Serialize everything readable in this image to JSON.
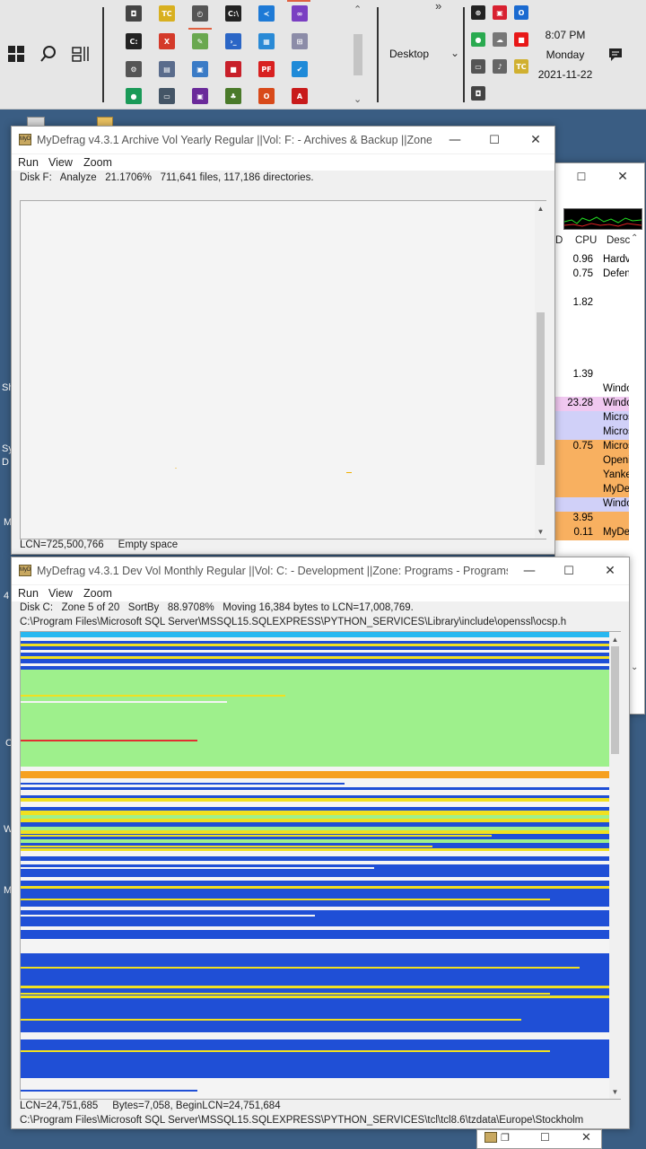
{
  "taskbar": {
    "toolbar_label": "Desktop",
    "overflow_glyph": "»",
    "clock": {
      "time": "8:07 PM",
      "day": "Monday",
      "date": "2021-11-22"
    },
    "pinned_icons": [
      {
        "name": "camera-tool-icon",
        "bg": "#444444",
        "glyph": "◘"
      },
      {
        "name": "tc-tool-icon",
        "bg": "#d8b020",
        "glyph": "TC"
      },
      {
        "name": "clock-check-icon",
        "bg": "#555555",
        "glyph": "◴"
      },
      {
        "name": "console-icon",
        "bg": "#222222",
        "glyph": "C:\\"
      },
      {
        "name": "vscode-icon",
        "bg": "#1e7ad6",
        "glyph": "≺"
      },
      {
        "name": "visual-studio-icon",
        "bg": "#7a3fc2",
        "glyph": "∞"
      },
      {
        "name": "command-prompt-icon",
        "bg": "#222222",
        "glyph": "C:"
      },
      {
        "name": "vcxsrv-icon",
        "bg": "#d43a2a",
        "glyph": "X"
      },
      {
        "name": "paint-icon",
        "bg": "#6aa84f",
        "glyph": "✎"
      },
      {
        "name": "powershell-icon",
        "bg": "#2b66c6",
        "glyph": "›_"
      },
      {
        "name": "calculator-grid-icon",
        "bg": "#2a8ad6",
        "glyph": "▦"
      },
      {
        "name": "network-tool-icon",
        "bg": "#8c8ca8",
        "glyph": "⊞"
      },
      {
        "name": "settings-icon",
        "bg": "#555555",
        "glyph": "⚙"
      },
      {
        "name": "server-manager-icon",
        "bg": "#5a6c8c",
        "glyph": "▤"
      },
      {
        "name": "control-panel-icon",
        "bg": "#3a7bc6",
        "glyph": "▣"
      },
      {
        "name": "red-app-icon",
        "bg": "#c8202a",
        "glyph": "■"
      },
      {
        "name": "pdf-editor-icon",
        "bg": "#d82020",
        "glyph": "PF"
      },
      {
        "name": "checklist-icon",
        "bg": "#1e8ad8",
        "glyph": "✔"
      },
      {
        "name": "green-app-icon",
        "bg": "#1a9a58",
        "glyph": "●"
      },
      {
        "name": "monitor-tool-icon",
        "bg": "#445566",
        "glyph": "▭"
      },
      {
        "name": "hyperv-icon",
        "bg": "#6a2a9a",
        "glyph": "▣"
      },
      {
        "name": "tree-app-icon",
        "bg": "#4a7a2a",
        "glyph": "♣"
      },
      {
        "name": "office-icon",
        "bg": "#d84a1a",
        "glyph": "O"
      },
      {
        "name": "acrobat-icon",
        "bg": "#c81a1a",
        "glyph": "A"
      }
    ],
    "tray_icons": [
      {
        "name": "tray-circle-icon",
        "bg": "#222222",
        "glyph": "⊛"
      },
      {
        "name": "tray-red-icon",
        "bg": "#d82030",
        "glyph": "▣"
      },
      {
        "name": "tray-outlook-icon",
        "bg": "#1a6ad0",
        "glyph": "O"
      },
      {
        "name": "tray-green-owl-icon",
        "bg": "#2aaa50",
        "glyph": "●"
      },
      {
        "name": "onedrive-icon",
        "bg": "#777777",
        "glyph": "☁"
      },
      {
        "name": "tray-stop-icon",
        "bg": "#e81818",
        "glyph": "■"
      },
      {
        "name": "network-icon",
        "bg": "#555555",
        "glyph": "▭"
      },
      {
        "name": "volume-icon",
        "bg": "#666666",
        "glyph": "♪"
      },
      {
        "name": "tray-tc-icon",
        "bg": "#d0b030",
        "glyph": "TC"
      },
      {
        "name": "tray-camera-icon",
        "bg": "#444444",
        "glyph": "◘"
      }
    ]
  },
  "menu": {
    "run": "Run",
    "view": "View",
    "zoom": "Zoom"
  },
  "window_f": {
    "title": "MyDefrag v4.3.1   Archive Vol Yearly Regular ||Vol: F: - Archives & Backup ||Zone: ...",
    "status": "Disk F:   Analyze   21.1706%   711,641 files, 117,186 directories.",
    "footer": "LCN=725,500,766     Empty space"
  },
  "window_c": {
    "title": "MyDefrag v4.3.1   Dev Vol Monthly Regular ||Vol: C: - Development ||Zone: Programs - Programs |...",
    "status": "Disk C:   Zone 5 of 20   SortBy   88.9708%   Moving 16,384 bytes to LCN=17,008,769.",
    "path": "C:\\Program Files\\Microsoft SQL Server\\MSSQL15.SQLEXPRESS\\PYTHON_SERVICES\\Library\\include\\openssl\\ocsp.h",
    "footer": "LCN=24,751,685     Bytes=7,058, BeginLCN=24,751,684",
    "footer_path": "C:\\Program Files\\Microsoft SQL Server\\MSSQL15.SQLEXPRESS\\PYTHON_SERVICES\\tcl\\tcl8.6\\tzdata\\Europe\\Stockholm",
    "map_colors": {
      "moved": "#1f4fd6",
      "fragmented": "#f0e020",
      "unfragmented": "#9ef08c",
      "mft": "#f6a020",
      "reserved": "#28b8f0",
      "free": "#f4f4f4",
      "busy": "#e03030"
    }
  },
  "task_manager": {
    "col_cpu": "CPU",
    "col_desc": "Desc",
    "col_d": "D",
    "rows": [
      {
        "cpu": "0.96",
        "desc": "Hardv",
        "bg": "#ffffff"
      },
      {
        "cpu": "0.75",
        "desc": "Defen",
        "bg": "#ffffff"
      },
      {
        "cpu": "",
        "desc": "",
        "bg": "#ffffff"
      },
      {
        "cpu": "1.82",
        "desc": "",
        "bg": "#ffffff"
      },
      {
        "cpu": "",
        "desc": "",
        "bg": "#ffffff"
      },
      {
        "cpu": "",
        "desc": "",
        "bg": "#ffffff"
      },
      {
        "cpu": "",
        "desc": "",
        "bg": "#ffffff"
      },
      {
        "cpu": "",
        "desc": "",
        "bg": "#ffffff"
      },
      {
        "cpu": "1.39",
        "desc": "",
        "bg": "#ffffff"
      },
      {
        "cpu": "",
        "desc": "Windo",
        "bg": "#ffffff"
      },
      {
        "cpu": "23.28",
        "desc": "Windo",
        "bg": "#f0c8f0"
      },
      {
        "cpu": "",
        "desc": "Micros",
        "bg": "#d0d0f8"
      },
      {
        "cpu": "",
        "desc": "Micros",
        "bg": "#d0d0f8"
      },
      {
        "cpu": "0.75",
        "desc": "Micros",
        "bg": "#f8b060"
      },
      {
        "cpu": "",
        "desc": "Openi",
        "bg": "#f8b060"
      },
      {
        "cpu": "",
        "desc": "Yanke",
        "bg": "#f8b060"
      },
      {
        "cpu": "",
        "desc": "MyDe",
        "bg": "#f8b060"
      },
      {
        "cpu": "",
        "desc": "Windo",
        "bg": "#d0d0f8"
      },
      {
        "cpu": "3.95",
        "desc": "",
        "bg": "#f8b060"
      },
      {
        "cpu": "0.11",
        "desc": "MyDe",
        "bg": "#f8b060"
      }
    ]
  },
  "desktop_labels": [
    "Sh",
    "Sy",
    "D",
    "M",
    "4",
    "C",
    "W",
    "M"
  ]
}
